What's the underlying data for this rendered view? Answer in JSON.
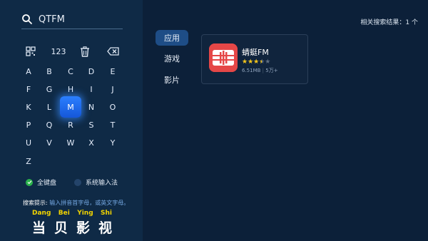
{
  "search": {
    "query": "QTFM"
  },
  "keyboard": {
    "tools": [
      "123"
    ],
    "rows": [
      [
        "A",
        "B",
        "C",
        "D",
        "E"
      ],
      [
        "F",
        "G",
        "H",
        "I",
        "J"
      ],
      [
        "K",
        "L",
        "M",
        "N",
        "O"
      ],
      [
        "P",
        "Q",
        "R",
        "S",
        "T"
      ],
      [
        "U",
        "V",
        "W",
        "X",
        "Y"
      ],
      [
        "Z"
      ]
    ],
    "selected": "M"
  },
  "options": {
    "full_keyboard": "全键盘",
    "system_input": "系统输入法"
  },
  "hint": {
    "label": "搜索提示:",
    "text": "输入拼音首字母，或英文字母。"
  },
  "logo": {
    "pinyin": [
      "Dang",
      "Bei",
      "Ying",
      "Shi"
    ],
    "hanzi": [
      "当",
      "贝",
      "影",
      "视"
    ]
  },
  "tabs": [
    "应用",
    "游戏",
    "影片"
  ],
  "result_count": "相关搜索结果：1 个",
  "results": [
    {
      "name": "蜻蜓FM",
      "rating": 3.5,
      "stars": "★★★★★",
      "size": "6.51MB",
      "downloads": "5万+"
    }
  ],
  "colors": {
    "accent": "#2b7fff",
    "tab_active": "#1e4d86",
    "logo_pinyin": "#f2d400",
    "app_icon": "#e54747",
    "star": "#f5c518"
  }
}
